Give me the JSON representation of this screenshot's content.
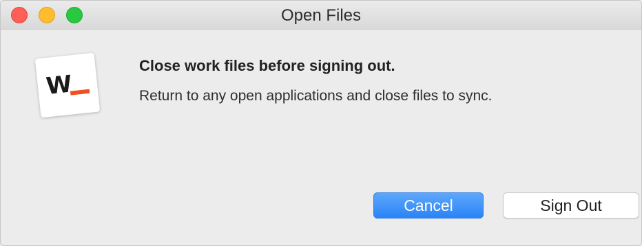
{
  "window": {
    "title": "Open Files"
  },
  "app_icon": {
    "name": "w-app-icon",
    "letter": "W",
    "accent_color": "#f04e23"
  },
  "dialog": {
    "headline": "Close work files before signing out.",
    "message": "Return to any open applications and close files to sync."
  },
  "buttons": {
    "cancel_label": "Cancel",
    "sign_out_label": "Sign Out"
  },
  "colors": {
    "accent": "#2a84f6",
    "close": "#fe5f57",
    "minimize": "#febc2e",
    "zoom": "#28c840"
  }
}
